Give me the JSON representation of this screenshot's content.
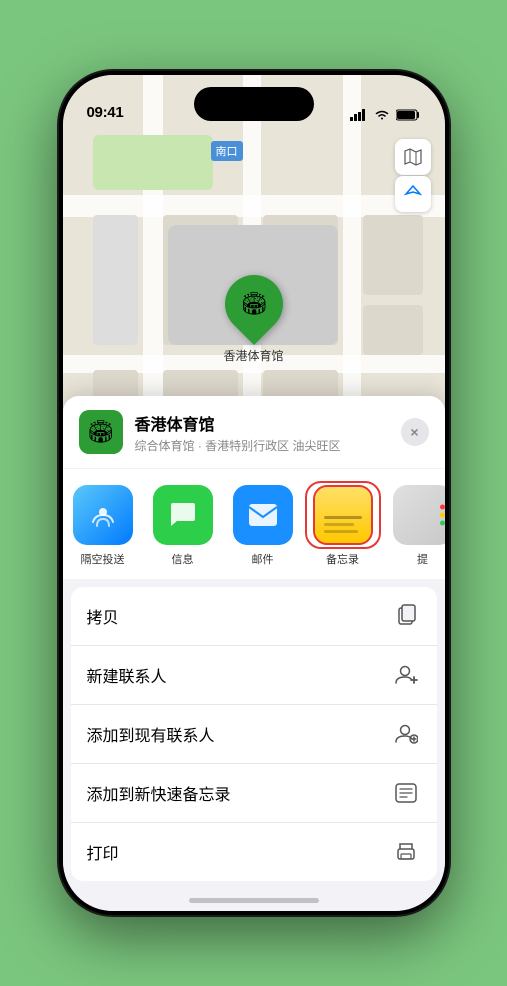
{
  "status_bar": {
    "time": "09:41",
    "location_arrow": "▶",
    "signal": "●●●●",
    "wifi": "wifi",
    "battery": "battery"
  },
  "map": {
    "label_south_entrance": "南口",
    "label_south_entrance_prefix": "南口",
    "venue_name": "香港体育馆",
    "btn_map": "🗺",
    "btn_location": "➤"
  },
  "location_header": {
    "name": "香港体育馆",
    "subtitle": "综合体育馆 · 香港特别行政区 油尖旺区",
    "close": "×"
  },
  "share_items": [
    {
      "id": "airdrop",
      "label": "隔空投送",
      "type": "airdrop"
    },
    {
      "id": "messages",
      "label": "信息",
      "type": "messages"
    },
    {
      "id": "mail",
      "label": "邮件",
      "type": "mail"
    },
    {
      "id": "notes",
      "label": "备忘录",
      "type": "notes"
    },
    {
      "id": "more",
      "label": "提",
      "type": "more"
    }
  ],
  "action_items": [
    {
      "id": "copy",
      "label": "拷贝",
      "icon": "copy"
    },
    {
      "id": "new-contact",
      "label": "新建联系人",
      "icon": "person-add"
    },
    {
      "id": "add-existing",
      "label": "添加到现有联系人",
      "icon": "person-existing"
    },
    {
      "id": "quick-note",
      "label": "添加到新快速备忘录",
      "icon": "note"
    },
    {
      "id": "print",
      "label": "打印",
      "icon": "print"
    }
  ],
  "colors": {
    "green_bg": "#7bc67e",
    "marker_green": "#2d9c35",
    "highlight_border": "#e63835",
    "map_road": "#ffffff",
    "map_bg": "#e8e4d8"
  }
}
